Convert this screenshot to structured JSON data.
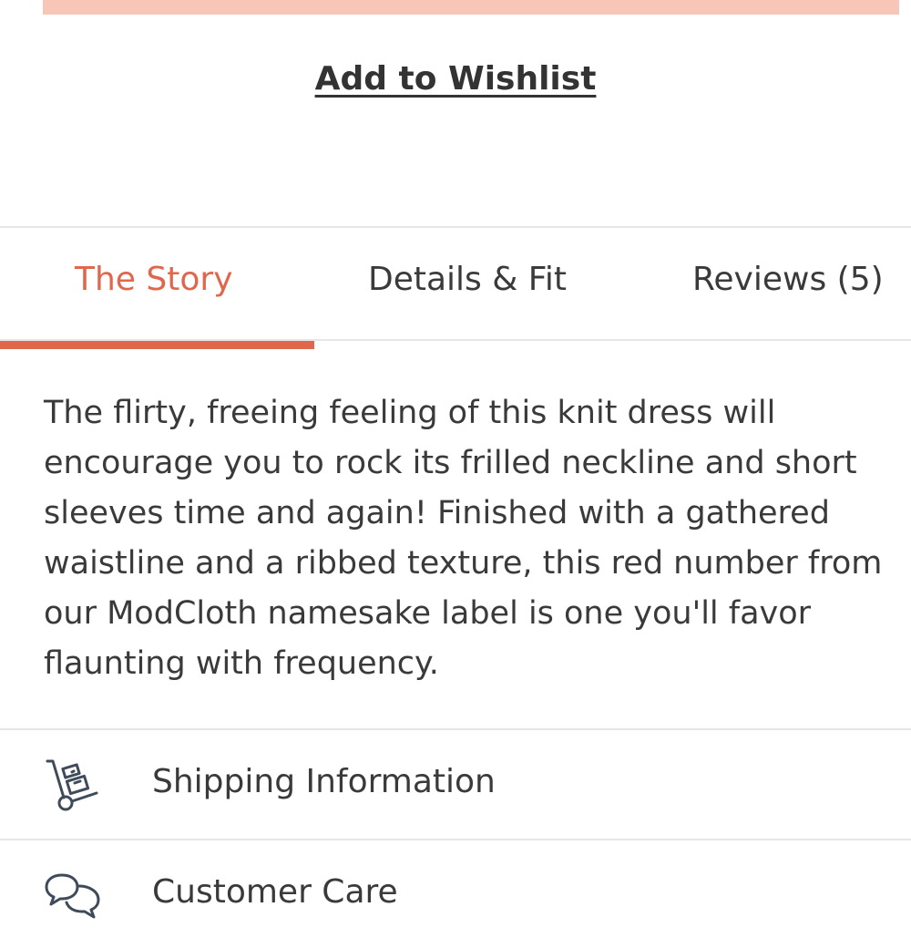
{
  "colors": {
    "accent": "#e0664c",
    "top_bar": "#f8c6b6",
    "text": "#3a3a3a",
    "divider": "#e6e6e6"
  },
  "wishlist": {
    "label": "Add to Wishlist"
  },
  "tabs": [
    {
      "label": "The Story",
      "active": true
    },
    {
      "label": "Details & Fit",
      "active": false
    },
    {
      "label": "Reviews (5)",
      "active": false
    }
  ],
  "story": {
    "text": "The flirty, freeing feeling of this knit dress will encourage you to rock its frilled neckline and short sleeves time and again! Finished with a gathered waistline and a ribbed texture, this red number from our ModCloth namesake label is one you'll favor flaunting with frequency."
  },
  "info_rows": [
    {
      "icon": "hand-truck-icon",
      "label": "Shipping Information"
    },
    {
      "icon": "chat-bubbles-icon",
      "label": "Customer Care"
    }
  ]
}
